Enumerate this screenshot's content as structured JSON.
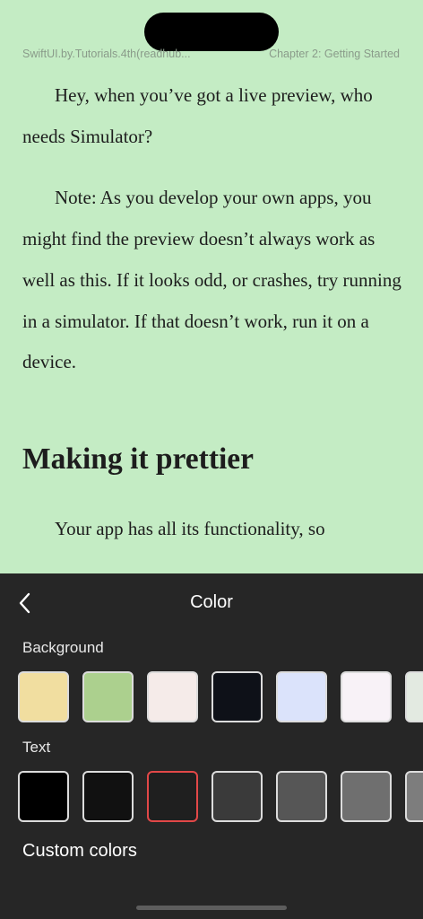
{
  "header": {
    "book_title": "SwiftUI.by.Tutorials.4th(readhub...",
    "chapter_title": "Chapter 2: Getting Started"
  },
  "reader": {
    "paragraphs": [
      "Hey, when you’ve got a live preview, who needs Simulator?",
      "Note: As you develop your own apps, you might find the preview doesn’t always work as well as this. If it looks odd, or crashes, try running in a simulator. If that doesn’t work, run it on a device."
    ],
    "heading": "Making it prettier",
    "after_heading": "Your app has all its functionality, so"
  },
  "panel": {
    "title": "Color",
    "back_icon": "chevron-left-icon",
    "background_label": "Background",
    "text_label": "Text",
    "custom_colors_label": "Custom colors",
    "background_swatches": [
      "#f1dea0",
      "#acd08e",
      "#f5ebe9",
      "#0e1118",
      "#dbe3fb",
      "#f8f2f7",
      "#e3eae1"
    ],
    "text_swatches": [
      "#000000",
      "#111111",
      "#1f1f1f",
      "#3a3a3a",
      "#565656",
      "#6f6f6f",
      "#7d7d7d"
    ],
    "selected_text_swatch": 2,
    "selected_color": "#e24848"
  }
}
